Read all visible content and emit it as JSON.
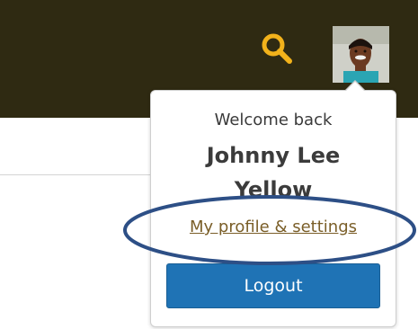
{
  "header": {
    "search_icon": "magnifying-glass",
    "avatar_icon": "user-photo",
    "search_color": "#f2b21b",
    "background_color": "#2f2a12"
  },
  "dropdown": {
    "welcome_text": "Welcome back",
    "user_name": "Johnny Lee Yellow",
    "profile_link": "My profile & settings",
    "logout_label": "Logout",
    "logout_color": "#1f73b5",
    "highlight_color": "#2d4f86"
  }
}
